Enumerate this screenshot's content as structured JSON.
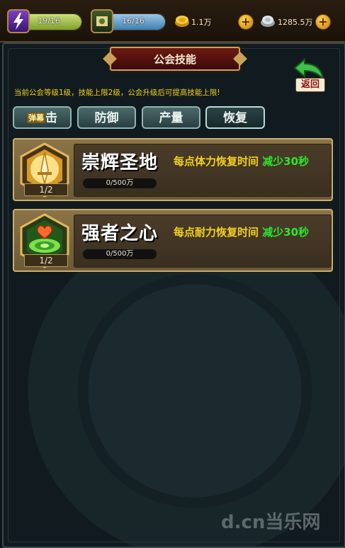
{
  "topbar": {
    "energy": {
      "value": "19/16",
      "fill_fraction": 1.0
    },
    "stamina": {
      "value": "16/16",
      "fill_fraction": 1.0
    },
    "gold": "1.1万",
    "silver": "1285.5万"
  },
  "title": "公会技能",
  "back_label": "返回",
  "notice": "当前公会等级1级，技能上限2级，公会升级后可提高技能上限!",
  "tabs": [
    {
      "label_small": "弹幕",
      "label": "击",
      "active": false
    },
    {
      "label": "防御",
      "active": false
    },
    {
      "label": "产量",
      "active": false
    },
    {
      "label": "恢复",
      "active": true
    }
  ],
  "skills": [
    {
      "name": "崇辉圣地",
      "level": "1/2",
      "progress": "0/500万",
      "desc_prefix": "每点体力恢复时间",
      "desc_highlight": "减少30秒",
      "icon": "golden-sword-icon"
    },
    {
      "name": "强者之心",
      "level": "1/2",
      "progress": "0/500万",
      "desc_prefix": "每点耐力恢复时间",
      "desc_highlight": "减少30秒",
      "icon": "heart-target-icon"
    }
  ],
  "watermark": "d.cn当乐网",
  "colors": {
    "accent_yellow": "#f2d020",
    "accent_green": "#2ee62e",
    "panel_brown": "#8b7445"
  }
}
